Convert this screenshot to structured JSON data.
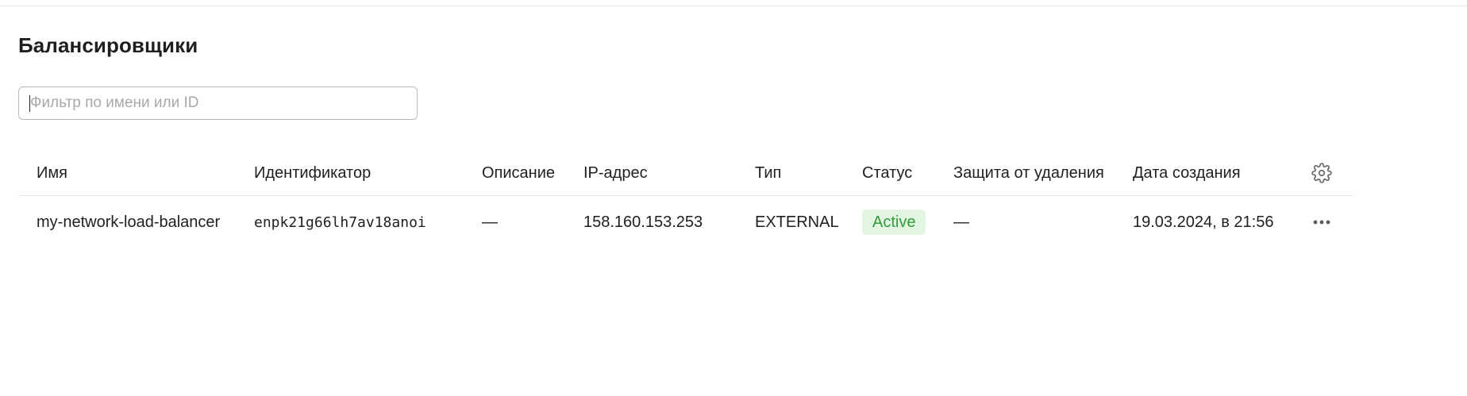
{
  "page": {
    "title": "Балансировщики"
  },
  "filter": {
    "placeholder": "Фильтр по имени или ID",
    "value": ""
  },
  "table": {
    "columns": [
      "Имя",
      "Идентификатор",
      "Описание",
      "IP-адрес",
      "Тип",
      "Статус",
      "Защита от удаления",
      "Дата создания"
    ],
    "settings_icon": "gear-icon",
    "rows": [
      {
        "name": "my-network-load-balancer",
        "id": "enpk21g66lh7av18anoi",
        "description": "—",
        "ip": "158.160.153.253",
        "type": "EXTERNAL",
        "status": "Active",
        "deletion_protection": "—",
        "created": "19.03.2024, в 21:56",
        "actions_icon": "more-horizontal-icon"
      }
    ]
  },
  "colors": {
    "status_active_bg": "#e3f6e1",
    "status_active_text": "#2f9b3a",
    "divider": "#e6e6e6",
    "text": "#1f1f1f"
  }
}
